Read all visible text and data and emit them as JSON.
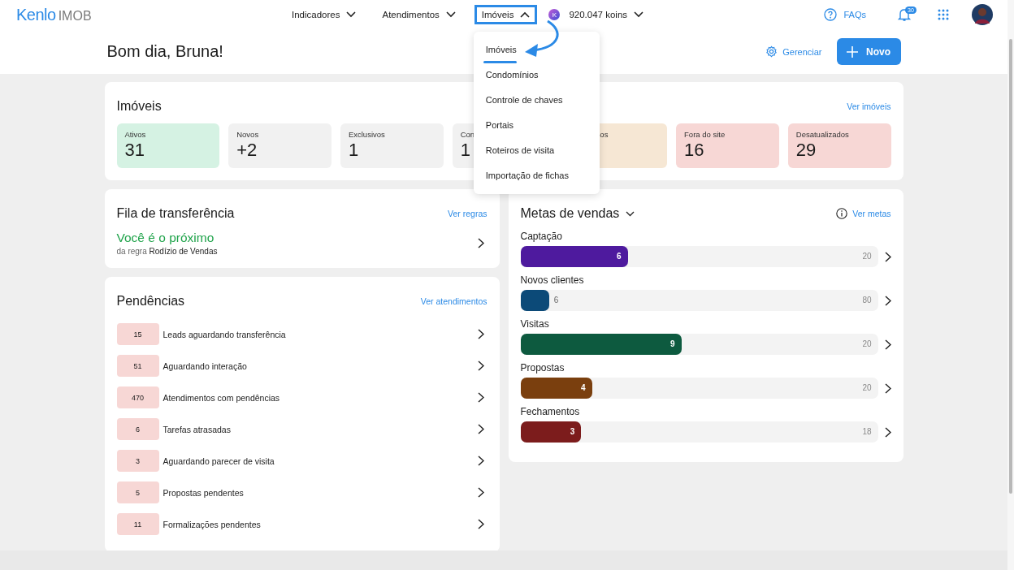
{
  "brand": {
    "name": "Kenlo",
    "product": "IMOB"
  },
  "nav": [
    {
      "label": "Indicadores",
      "expanded": false,
      "highlighted": false
    },
    {
      "label": "Atendimentos",
      "expanded": false,
      "highlighted": false
    },
    {
      "label": "Imóveis",
      "expanded": true,
      "highlighted": true
    }
  ],
  "koins": "920.047 koins",
  "koin_symbol": "K",
  "faq": "FAQs",
  "notifications_badge": "30",
  "dropdown": [
    {
      "label": "Imóveis",
      "selected": true
    },
    {
      "label": "Condomínios",
      "selected": false
    },
    {
      "label": "Controle de chaves",
      "selected": false
    },
    {
      "label": "Portais",
      "selected": false
    },
    {
      "label": "Roteiros de visita",
      "selected": false
    },
    {
      "label": "Importação de fichas",
      "selected": false
    }
  ],
  "greeting": "Bom dia, Bruna!",
  "manage": "Gerenciar",
  "new_button": "Novo",
  "properties": {
    "title": "Imóveis",
    "link": "Ver imóveis",
    "stats": [
      {
        "kind": "tile",
        "label": "Ativos",
        "value": "31",
        "color": "#d5f2e3"
      },
      {
        "kind": "tile",
        "label": "Novos",
        "value": "+2",
        "color": "#f1f1f1"
      },
      {
        "kind": "tile",
        "label": "Exclusivos",
        "value": "1",
        "color": "#f1f1f1"
      },
      {
        "kind": "tile",
        "label": "Con",
        "value": "1",
        "color": "#f1f1f1"
      },
      {
        "kind": "covered",
        "label": "os",
        "color": "#f6e7d4"
      },
      {
        "kind": "tile",
        "label": "Fora do site",
        "value": "16",
        "color": "#f7d7d5"
      },
      {
        "kind": "tile",
        "label": "Desatualizados",
        "value": "29",
        "color": "#f7d7d5"
      }
    ]
  },
  "queue": {
    "title": "Fila de transferência",
    "link": "Ver regras",
    "status": "Você é o próximo",
    "rule": "da regra **Rodízio de Vendas**"
  },
  "pending": {
    "title": "Pendências",
    "link": "Ver atendimentos",
    "items": [
      {
        "count": "15",
        "label": "Leads aguardando transferência"
      },
      {
        "count": "51",
        "label": "Aguardando interação"
      },
      {
        "count": "470",
        "label": "Atendimentos com pendências"
      },
      {
        "count": "6",
        "label": "Tarefas atrasadas"
      },
      {
        "count": "3",
        "label": "Aguardando parecer de visita"
      },
      {
        "count": "5",
        "label": "Propostas pendentes"
      },
      {
        "count": "11",
        "label": "Formalizações pendentes"
      }
    ]
  },
  "goals": {
    "title": "Metas de vendas",
    "link": "Ver metas",
    "items": [
      {
        "name": "Captação",
        "value": "6",
        "target": "20",
        "level": 0.3,
        "color": "#4e1a9e"
      },
      {
        "name": "Novos clientes",
        "value": "6",
        "target": "80",
        "level": 0.08,
        "color": "#0c4a78"
      },
      {
        "name": "Visitas",
        "value": "9",
        "target": "20",
        "level": 0.45,
        "color": "#0d5a3f"
      },
      {
        "name": "Propostas",
        "value": "4",
        "target": "20",
        "level": 0.2,
        "color": "#7a3f0e"
      },
      {
        "name": "Fechamentos",
        "value": "3",
        "target": "18",
        "level": 0.17,
        "color": "#7c1c1c"
      }
    ]
  }
}
